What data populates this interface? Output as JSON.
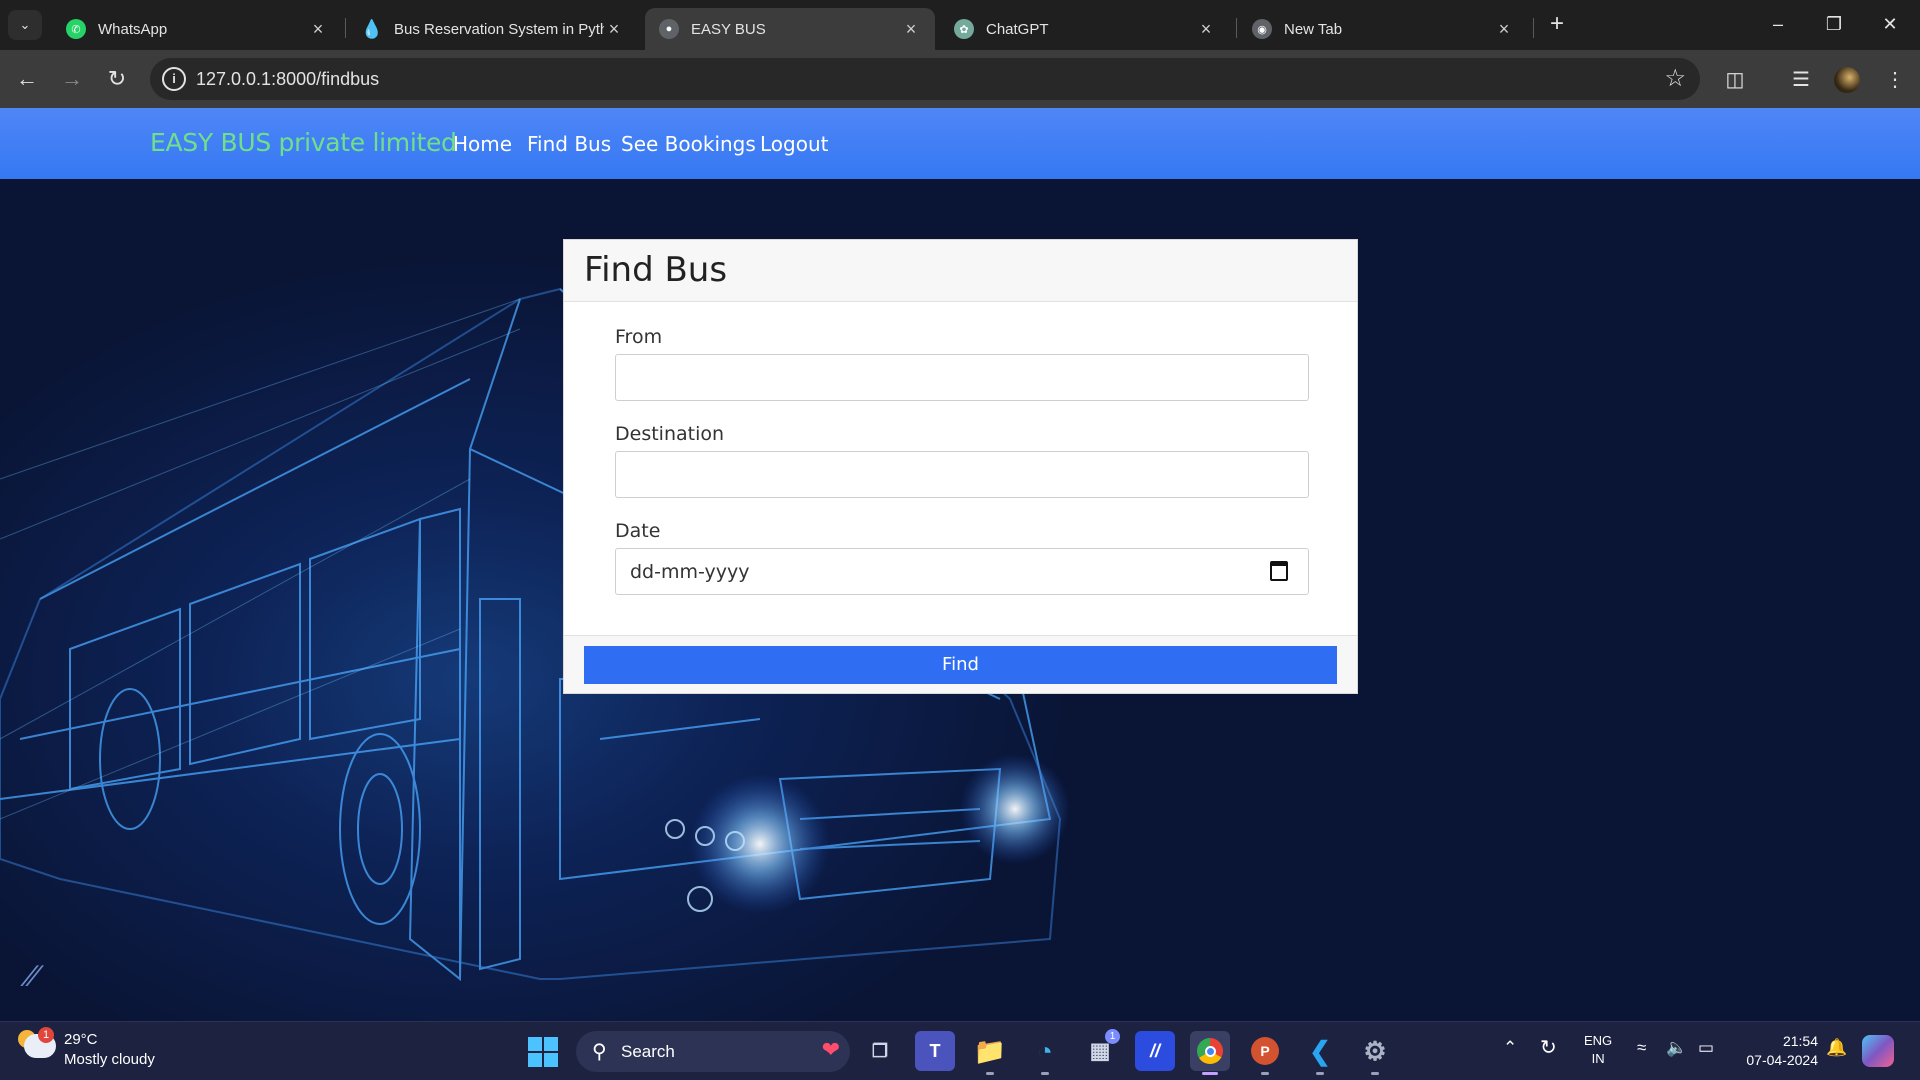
{
  "browser": {
    "tabs": [
      {
        "title": "WhatsApp",
        "icon": "whatsapp-icon",
        "color": "#25d366",
        "active": false
      },
      {
        "title": "Bus Reservation System in Pyth",
        "icon": "drupal-icon",
        "color": "#2a7fff",
        "active": false
      },
      {
        "title": "EASY BUS",
        "icon": "globe-icon",
        "color": "#9aa0a6",
        "active": true
      },
      {
        "title": "ChatGPT",
        "icon": "chatgpt-icon",
        "color": "#74aa9c",
        "active": false
      },
      {
        "title": "New Tab",
        "icon": "chrome-icon",
        "color": "#9aa0a6",
        "active": false
      }
    ],
    "url": "127.0.0.1:8000/findbus"
  },
  "site": {
    "brand": "EASY BUS private limited",
    "nav": [
      "Home",
      "Find Bus",
      "See Bookings",
      "Logout"
    ],
    "brand_color": "#6fe08a",
    "nav_color": "#3578f2"
  },
  "form": {
    "title": "Find Bus",
    "from_label": "From",
    "from_value": "",
    "destination_label": "Destination",
    "destination_value": "",
    "date_label": "Date",
    "date_placeholder": "dd-mm-yyyy",
    "submit_label": "Find",
    "button_color": "#2f6ef2"
  },
  "taskbar": {
    "weather_badge": "1",
    "temperature": "29°C",
    "weather": "Mostly cloudy",
    "search_label": "Search",
    "store_badge": "1",
    "language_line1": "ENG",
    "language_line2": "IN",
    "time": "21:54",
    "date": "07-04-2024"
  }
}
